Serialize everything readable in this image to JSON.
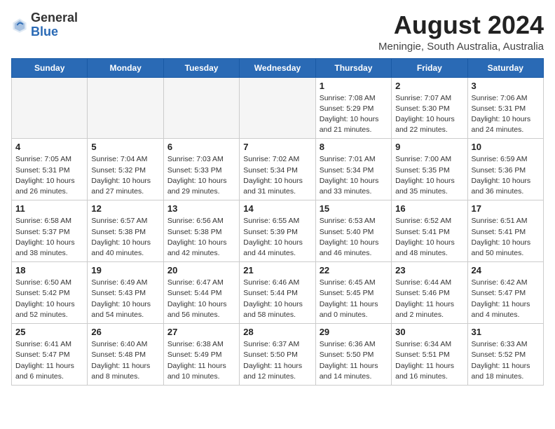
{
  "header": {
    "logo_general": "General",
    "logo_blue": "Blue",
    "month_year": "August 2024",
    "location": "Meningie, South Australia, Australia"
  },
  "days_of_week": [
    "Sunday",
    "Monday",
    "Tuesday",
    "Wednesday",
    "Thursday",
    "Friday",
    "Saturday"
  ],
  "weeks": [
    [
      {
        "day": "",
        "info": ""
      },
      {
        "day": "",
        "info": ""
      },
      {
        "day": "",
        "info": ""
      },
      {
        "day": "",
        "info": ""
      },
      {
        "day": "1",
        "info": "Sunrise: 7:08 AM\nSunset: 5:29 PM\nDaylight: 10 hours\nand 21 minutes."
      },
      {
        "day": "2",
        "info": "Sunrise: 7:07 AM\nSunset: 5:30 PM\nDaylight: 10 hours\nand 22 minutes."
      },
      {
        "day": "3",
        "info": "Sunrise: 7:06 AM\nSunset: 5:31 PM\nDaylight: 10 hours\nand 24 minutes."
      }
    ],
    [
      {
        "day": "4",
        "info": "Sunrise: 7:05 AM\nSunset: 5:31 PM\nDaylight: 10 hours\nand 26 minutes."
      },
      {
        "day": "5",
        "info": "Sunrise: 7:04 AM\nSunset: 5:32 PM\nDaylight: 10 hours\nand 27 minutes."
      },
      {
        "day": "6",
        "info": "Sunrise: 7:03 AM\nSunset: 5:33 PM\nDaylight: 10 hours\nand 29 minutes."
      },
      {
        "day": "7",
        "info": "Sunrise: 7:02 AM\nSunset: 5:34 PM\nDaylight: 10 hours\nand 31 minutes."
      },
      {
        "day": "8",
        "info": "Sunrise: 7:01 AM\nSunset: 5:34 PM\nDaylight: 10 hours\nand 33 minutes."
      },
      {
        "day": "9",
        "info": "Sunrise: 7:00 AM\nSunset: 5:35 PM\nDaylight: 10 hours\nand 35 minutes."
      },
      {
        "day": "10",
        "info": "Sunrise: 6:59 AM\nSunset: 5:36 PM\nDaylight: 10 hours\nand 36 minutes."
      }
    ],
    [
      {
        "day": "11",
        "info": "Sunrise: 6:58 AM\nSunset: 5:37 PM\nDaylight: 10 hours\nand 38 minutes."
      },
      {
        "day": "12",
        "info": "Sunrise: 6:57 AM\nSunset: 5:38 PM\nDaylight: 10 hours\nand 40 minutes."
      },
      {
        "day": "13",
        "info": "Sunrise: 6:56 AM\nSunset: 5:38 PM\nDaylight: 10 hours\nand 42 minutes."
      },
      {
        "day": "14",
        "info": "Sunrise: 6:55 AM\nSunset: 5:39 PM\nDaylight: 10 hours\nand 44 minutes."
      },
      {
        "day": "15",
        "info": "Sunrise: 6:53 AM\nSunset: 5:40 PM\nDaylight: 10 hours\nand 46 minutes."
      },
      {
        "day": "16",
        "info": "Sunrise: 6:52 AM\nSunset: 5:41 PM\nDaylight: 10 hours\nand 48 minutes."
      },
      {
        "day": "17",
        "info": "Sunrise: 6:51 AM\nSunset: 5:41 PM\nDaylight: 10 hours\nand 50 minutes."
      }
    ],
    [
      {
        "day": "18",
        "info": "Sunrise: 6:50 AM\nSunset: 5:42 PM\nDaylight: 10 hours\nand 52 minutes."
      },
      {
        "day": "19",
        "info": "Sunrise: 6:49 AM\nSunset: 5:43 PM\nDaylight: 10 hours\nand 54 minutes."
      },
      {
        "day": "20",
        "info": "Sunrise: 6:47 AM\nSunset: 5:44 PM\nDaylight: 10 hours\nand 56 minutes."
      },
      {
        "day": "21",
        "info": "Sunrise: 6:46 AM\nSunset: 5:44 PM\nDaylight: 10 hours\nand 58 minutes."
      },
      {
        "day": "22",
        "info": "Sunrise: 6:45 AM\nSunset: 5:45 PM\nDaylight: 11 hours\nand 0 minutes."
      },
      {
        "day": "23",
        "info": "Sunrise: 6:44 AM\nSunset: 5:46 PM\nDaylight: 11 hours\nand 2 minutes."
      },
      {
        "day": "24",
        "info": "Sunrise: 6:42 AM\nSunset: 5:47 PM\nDaylight: 11 hours\nand 4 minutes."
      }
    ],
    [
      {
        "day": "25",
        "info": "Sunrise: 6:41 AM\nSunset: 5:47 PM\nDaylight: 11 hours\nand 6 minutes."
      },
      {
        "day": "26",
        "info": "Sunrise: 6:40 AM\nSunset: 5:48 PM\nDaylight: 11 hours\nand 8 minutes."
      },
      {
        "day": "27",
        "info": "Sunrise: 6:38 AM\nSunset: 5:49 PM\nDaylight: 11 hours\nand 10 minutes."
      },
      {
        "day": "28",
        "info": "Sunrise: 6:37 AM\nSunset: 5:50 PM\nDaylight: 11 hours\nand 12 minutes."
      },
      {
        "day": "29",
        "info": "Sunrise: 6:36 AM\nSunset: 5:50 PM\nDaylight: 11 hours\nand 14 minutes."
      },
      {
        "day": "30",
        "info": "Sunrise: 6:34 AM\nSunset: 5:51 PM\nDaylight: 11 hours\nand 16 minutes."
      },
      {
        "day": "31",
        "info": "Sunrise: 6:33 AM\nSunset: 5:52 PM\nDaylight: 11 hours\nand 18 minutes."
      }
    ]
  ]
}
